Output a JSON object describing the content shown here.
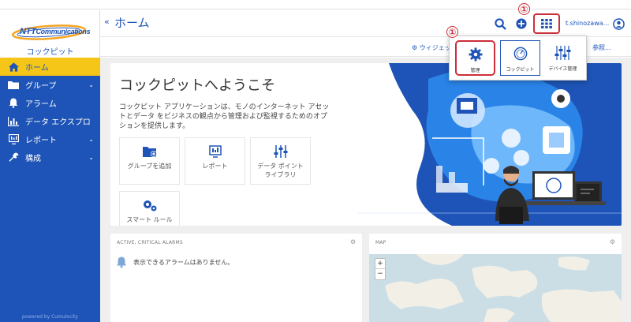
{
  "brand": {
    "logo_text_bold": "NTT",
    "logo_text": "Communications",
    "app_name": "コックピット"
  },
  "sidebar": {
    "items": [
      {
        "label": "ホーム",
        "icon": "home-icon",
        "active": true,
        "chevron": ""
      },
      {
        "label": "グループ",
        "icon": "folder-icon",
        "active": false,
        "chevron": "⌄"
      },
      {
        "label": "アラーム",
        "icon": "bell-icon",
        "active": false,
        "chevron": ""
      },
      {
        "label": "データ エクスプロ...",
        "icon": "bar-chart-icon",
        "active": false,
        "chevron": ""
      },
      {
        "label": "レポート",
        "icon": "report-icon",
        "active": false,
        "chevron": "⌄"
      },
      {
        "label": "構成",
        "icon": "wrench-icon",
        "active": false,
        "chevron": "⌄"
      }
    ],
    "powered_by": "powered by Cumulocity"
  },
  "header": {
    "back": "«",
    "title": "ホーム",
    "username": "t.shinozawa...",
    "marker_label": "①"
  },
  "subheader": {
    "widget_label": "⚙ ウィジェッ",
    "reference_label": "参照..."
  },
  "switcher": {
    "items": [
      {
        "label": "管理",
        "icon": "gear-icon"
      },
      {
        "label": "コックピット",
        "icon": "gauge-icon"
      },
      {
        "label": "デバイス管理",
        "icon": "sliders-icon"
      }
    ],
    "marker_label": "①"
  },
  "welcome": {
    "title": "コックピットへようこそ",
    "description": "コックピット アプリケーションは、モノのインターネット アセットとデータ をビジネスの観点から管理および監視するためのオプションを提供します。",
    "tiles": [
      {
        "label": "グループを追加",
        "icon": "folder-add-icon"
      },
      {
        "label": "レポート",
        "icon": "report-icon"
      },
      {
        "label": "データ ポイント ライブラリ",
        "icon": "sliders-icon"
      },
      {
        "label": "スマート ルール",
        "icon": "gears-icon"
      }
    ]
  },
  "alarms_card": {
    "title": "ACTIVE, CRITICAL ALARMS",
    "empty_text": "表示できるアラームはありません。"
  },
  "map_card": {
    "title": "MAP",
    "zoom_in": "+",
    "zoom_out": "−"
  },
  "colors": {
    "primary": "#1e54b7",
    "accent_yellow": "#f5c518",
    "highlight_red": "#cc2f3a"
  }
}
